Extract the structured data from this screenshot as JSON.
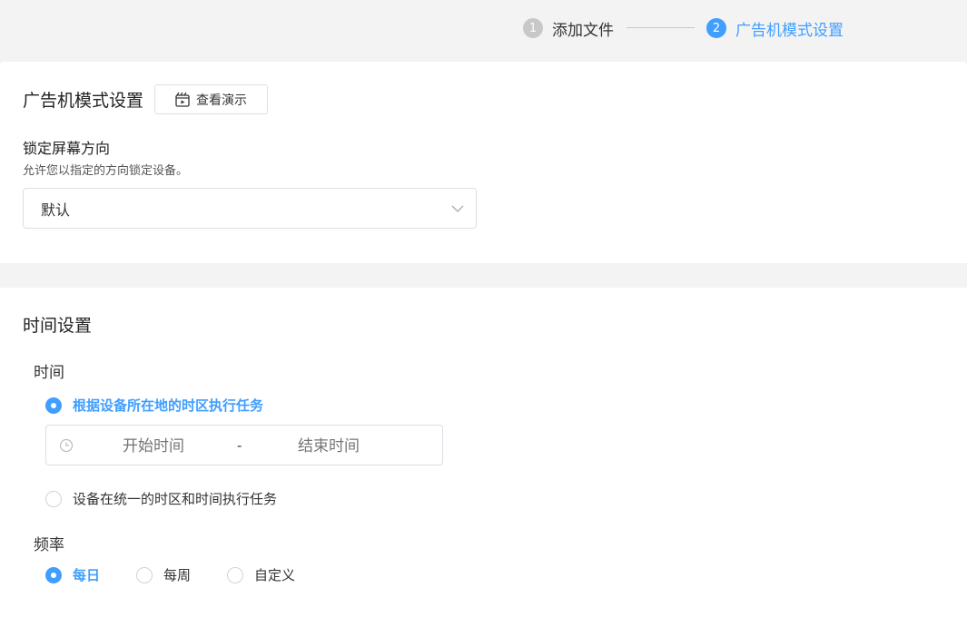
{
  "steps": [
    {
      "num": "1",
      "label": "添加文件"
    },
    {
      "num": "2",
      "label": "广告机模式设置"
    }
  ],
  "ad_mode": {
    "title": "广告机模式设置",
    "demo_button": "查看演示",
    "lock_label": "锁定屏幕方向",
    "lock_desc": "允许您以指定的方向锁定设备。",
    "lock_value": "默认"
  },
  "time_settings": {
    "title": "时间设置",
    "time_label": "时间",
    "option_local": "根据设备所在地的时区执行任务",
    "start_placeholder": "开始时间",
    "separator": "-",
    "end_placeholder": "结束时间",
    "option_unified": "设备在统一的时区和时间执行任务",
    "frequency_label": "频率",
    "freq_options": [
      "每日",
      "每周",
      "自定义"
    ]
  },
  "colors": {
    "accent": "#409eff",
    "inactive": "#c8c8c8",
    "background": "#f3f3f3"
  }
}
